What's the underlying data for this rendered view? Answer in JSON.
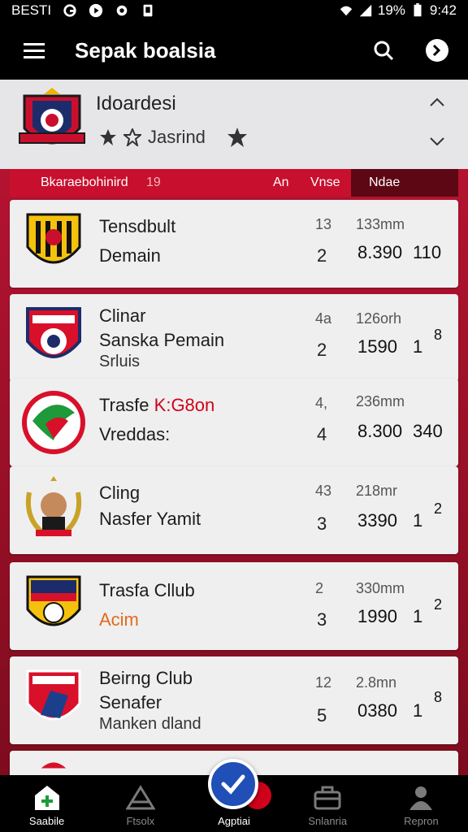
{
  "status_bar": {
    "carrier": "BESTI",
    "battery": "19%",
    "time": "9:42"
  },
  "app_bar": {
    "title": "Sepak boalsia"
  },
  "club_header": {
    "name": "Idoardesi",
    "rating_label": "Jasrind"
  },
  "columns": {
    "name": "Bkaraebohinird",
    "count": "19",
    "col_a": "An",
    "col_b": "Vnse",
    "selected": "Ndae"
  },
  "rows": [
    {
      "line1": "Tensdbult",
      "line2": "Demain",
      "line3": "",
      "s1": "13",
      "s2": "2",
      "s3": "133mm",
      "s4": "8.390",
      "s5": "110",
      "s6": ""
    },
    {
      "line1": "Clinar",
      "line2": "Sanska Pemain",
      "line3": "Srluis",
      "s1": "4a",
      "s2": "2",
      "s3": "126orh",
      "s4": "1590",
      "s5": "1",
      "s6": "8"
    },
    {
      "line1": "Trasfe",
      "line1_accent": "K:G8on",
      "line2": "Vreddas:",
      "line3": "",
      "s1": "4,",
      "s2": "4",
      "s3": "236mm",
      "s4": "8.300",
      "s5": "340",
      "s6": ""
    },
    {
      "line1": "Cling",
      "line2": "Nasfer Yamit",
      "line3": "",
      "s1": "43",
      "s2": "3",
      "s3": "218mr",
      "s4": "3390",
      "s5": "1",
      "s6": "2"
    },
    {
      "line1": "Trasfa Cllub",
      "line2": "Acim",
      "line3": "",
      "s1": "2",
      "s2": "3",
      "s3": "330mm",
      "s4": "1990",
      "s5": "1",
      "s6": "2"
    },
    {
      "line1": "Beirng Club",
      "line2": "Senafer",
      "line3": "Manken dland",
      "s1": "12",
      "s2": "5",
      "s3": "2.8mn",
      "s4": "0380",
      "s5": "1",
      "s6": "8"
    }
  ],
  "bottom_nav": [
    {
      "label": "Saabile",
      "icon": "home-plus-icon"
    },
    {
      "label": "Ftsolx",
      "icon": "stadium-icon"
    },
    {
      "label": "Agptiai",
      "icon": "check-icon"
    },
    {
      "label": "Snlanria",
      "icon": "briefcase-icon"
    },
    {
      "label": "Repron",
      "icon": "person-icon"
    }
  ],
  "colors": {
    "bar_bg": "#000000",
    "accent_red": "#c8102e",
    "fab_blue": "#1f4fb7",
    "card_bg": "#efefef"
  }
}
